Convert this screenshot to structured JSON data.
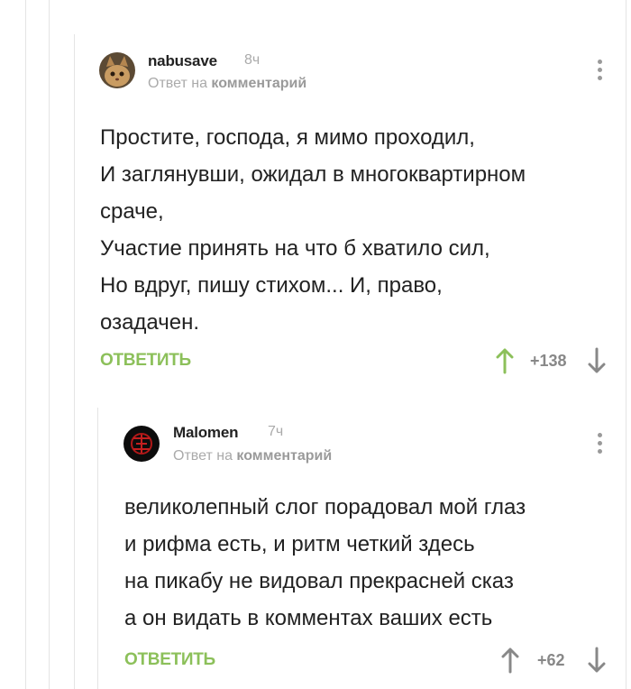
{
  "comments": [
    {
      "username": "nabusave",
      "time": "8ч",
      "reply_to_prefix": "Ответ на",
      "reply_to_link": "комментарий",
      "text": "Простите, господа, я мимо проходил,\nИ заглянувши, ожидал в многоквартирном\nсраче,\nУчастие принять на что б хватило сил,\nНо вдруг, пишу стихом... И, право,\nозадачен.",
      "reply_label": "ОТВЕТИТЬ",
      "rating": "+138",
      "upvote_color": "#8cc05a"
    },
    {
      "username": "Malomen",
      "time": "7ч",
      "reply_to_prefix": "Ответ на",
      "reply_to_link": "комментарий",
      "text": "великолепный слог порадовал мой глаз\nи рифма есть,  и ритм четкий здесь\nна пикабу не видовал прекрасней сказ\nа он видать в комментах ваших есть",
      "reply_label": "ОТВЕТИТЬ",
      "rating": "+62",
      "upvote_color": "#888888"
    }
  ]
}
